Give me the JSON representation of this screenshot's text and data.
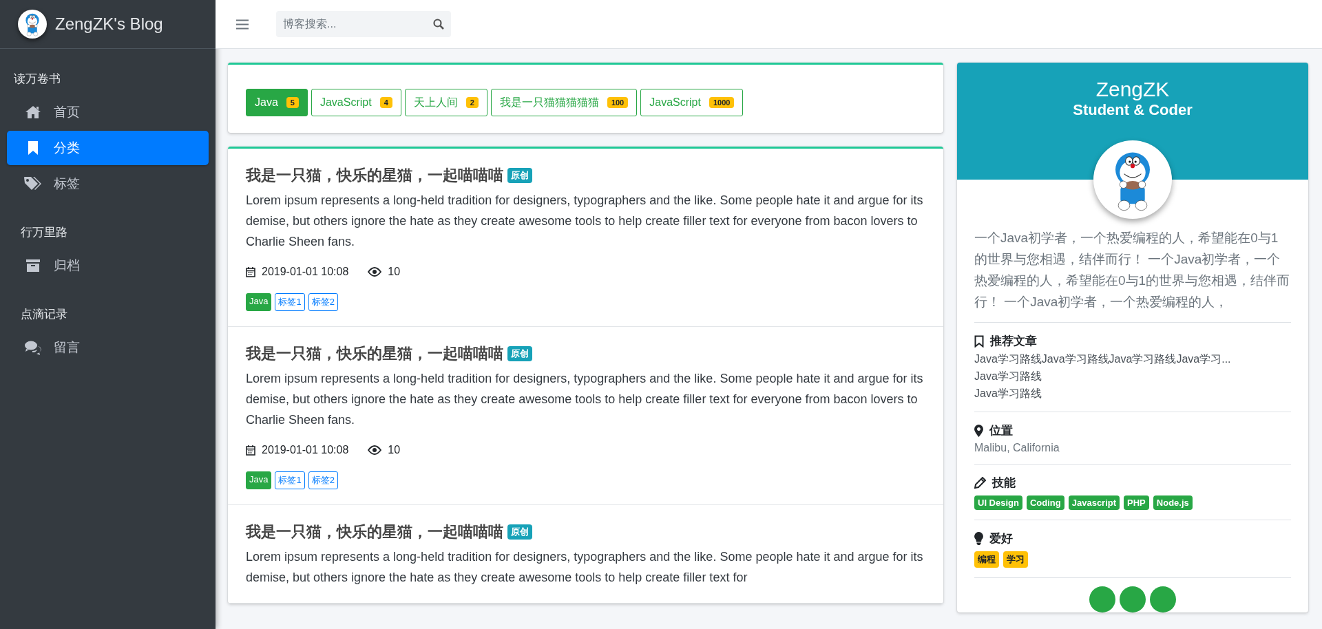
{
  "sidebar": {
    "brand": "ZengZK's Blog",
    "sections": [
      {
        "heading": "读万卷书",
        "items": [
          {
            "label": "首页",
            "selected": false
          },
          {
            "label": "分类",
            "selected": true
          },
          {
            "label": "标签",
            "selected": false
          }
        ]
      },
      {
        "heading": "行万里路",
        "items": [
          {
            "label": "归档",
            "selected": false
          }
        ]
      },
      {
        "heading": "点滴记录",
        "items": [
          {
            "label": "留言",
            "selected": false
          }
        ]
      }
    ]
  },
  "header": {
    "search": {
      "placeholder": "博客搜索..."
    }
  },
  "categories": [
    {
      "label": "Java",
      "count": "5",
      "selected": true
    },
    {
      "label": "JavaScript",
      "count": "4",
      "selected": false
    },
    {
      "label": "天上人间",
      "count": "2",
      "selected": false
    },
    {
      "label": "我是一只猫猫猫猫猫",
      "count": "100",
      "selected": false
    },
    {
      "label": "JavaScript",
      "count": "1000",
      "selected": false
    }
  ],
  "articles": [
    {
      "title": "我是一只猫，快乐的星猫，一起喵喵喵",
      "badge": "原创",
      "description": "Lorem ipsum represents a long-held tradition for designers, typographers and the like. Some people hate it and argue for its demise, but others ignore the hate as they create awesome tools to help create filler text for everyone from bacon lovers to Charlie Sheen fans.",
      "date": "2019-01-01 10:08",
      "views": "10",
      "tags": [
        {
          "label": "Java",
          "kind": "category"
        },
        {
          "label": "标签1",
          "kind": "tag"
        },
        {
          "label": "标签2",
          "kind": "tag"
        }
      ]
    },
    {
      "title": "我是一只猫，快乐的星猫，一起喵喵喵",
      "badge": "原创",
      "description": "Lorem ipsum represents a long-held tradition for designers, typographers and the like. Some people hate it and argue for its demise, but others ignore the hate as they create awesome tools to help create filler text for everyone from bacon lovers to Charlie Sheen fans.",
      "date": "2019-01-01 10:08",
      "views": "10",
      "tags": [
        {
          "label": "Java",
          "kind": "category"
        },
        {
          "label": "标签1",
          "kind": "tag"
        },
        {
          "label": "标签2",
          "kind": "tag"
        }
      ]
    },
    {
      "title": "我是一只猫，快乐的星猫，一起喵喵喵",
      "badge": "原创",
      "description": "Lorem ipsum represents a long-held tradition for designers, typographers and the like. Some people hate it and argue for its demise, but others ignore the hate as they create awesome tools to help create filler text for"
    }
  ],
  "profile": {
    "name": "ZengZK",
    "role": "Student & Coder",
    "bio": "一个Java初学者，一个热爱编程的人，希望能在0与1的世界与您相遇，结伴而行！ 一个Java初学者，一个热爱编程的人，希望能在0与1的世界与您相遇，结伴而行！ 一个Java初学者，一个热爱编程的人，",
    "sections": [
      {
        "kind": "list",
        "heading": "推荐文章",
        "items": [
          "Java学习路线Java学习路线Java学习路线Java学习...",
          "Java学习路线",
          "Java学习路线"
        ]
      },
      {
        "kind": "text",
        "heading": "位置",
        "text": "Malibu, California"
      },
      {
        "kind": "badges",
        "heading": "技能",
        "badges": [
          {
            "label": "UI Design",
            "color": "#28a745"
          },
          {
            "label": "Coding",
            "color": "#28a745"
          },
          {
            "label": "Javascript",
            "color": "#28a745"
          },
          {
            "label": "PHP",
            "color": "#28a745"
          },
          {
            "label": "Node.js",
            "color": "#28a745"
          }
        ]
      },
      {
        "kind": "badges",
        "heading": "爱好",
        "badges": [
          {
            "label": "编程",
            "color": "#ffc107"
          },
          {
            "label": "学习",
            "color": "#ffc107"
          }
        ]
      }
    ]
  }
}
